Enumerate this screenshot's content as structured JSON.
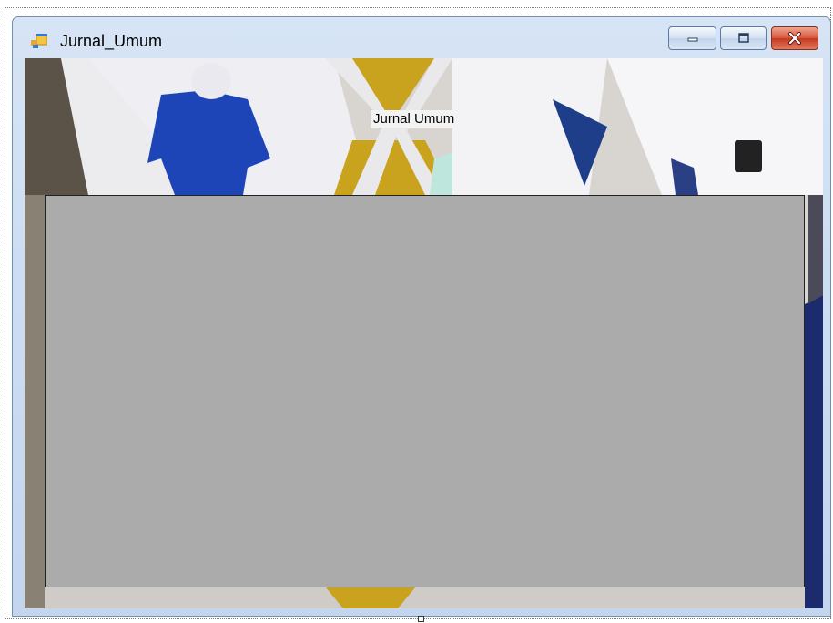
{
  "window": {
    "title": "Jurnal_Umum"
  },
  "form": {
    "header_label": "Jurnal Umum"
  },
  "colors": {
    "grid_background": "#ababab",
    "titlebar": "#d6e4f5",
    "close_button": "#c53a1f"
  },
  "icons": {
    "app": "form-icon",
    "minimize": "minimize-icon",
    "maximize": "maximize-icon",
    "close": "close-icon"
  }
}
